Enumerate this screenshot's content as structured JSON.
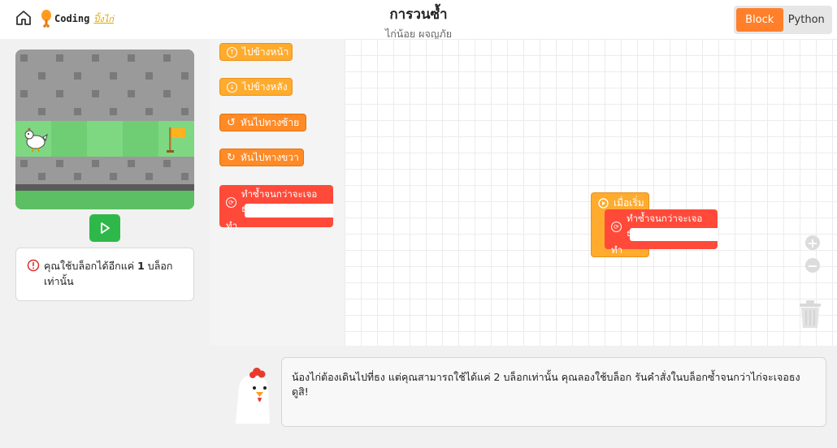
{
  "header": {
    "logo_text": "Coding",
    "logo_sub": "ปิ้งไก่",
    "title": "การวนซ้ำ",
    "subtitle": "ไก่น้อย ผจญภัย",
    "mode_options": [
      "Block",
      "Python"
    ],
    "active_mode": "Block"
  },
  "game": {
    "run_icon": "play-icon"
  },
  "message": {
    "icon": "warning-icon",
    "prefix": "คุณใช้บล็อกได้อีกแค่ ",
    "count": "1",
    "suffix": " บล็อก",
    "line2": "เท่านั้น"
  },
  "toolbox": {
    "blocks": [
      {
        "label": "ไปข้างหน้า",
        "icon": "forward-icon"
      },
      {
        "label": "ไปข้างหลัง",
        "icon": "backward-icon"
      },
      {
        "label": "หันไปทางซ้าย",
        "icon": "rotate-left-icon"
      },
      {
        "label": "หันไปทางขวา",
        "icon": "rotate-right-icon"
      }
    ],
    "loop": {
      "label": "ทำซ้ำจนกว่าจะเจอธง",
      "do_label": "ทำ",
      "icon": "loop-icon"
    }
  },
  "workspace": {
    "start_label": "เมื่อเริ่ม",
    "loop_label": "ทำซ้ำจนกว่าจะเจอธง",
    "do_label": "ทำ",
    "zoom_in": "+",
    "zoom_out": "−"
  },
  "hint": {
    "text": "น้องไก่ต้องเดินไปที่ธง แต่คุณสามารถใช้ได้แค่ 2 บล็อกเท่านั้น คุณลองใช้บล็อก รันคำสั่งในบล็อกซ้ำจนกว่าไก่จะเจอธง ดูสิ!"
  },
  "colors": {
    "accent": "#ff7f2a",
    "move_block": "#ffab2e",
    "loop_block": "#ff4a3a",
    "run_button": "#2fb84a",
    "path": "#7ed882"
  }
}
